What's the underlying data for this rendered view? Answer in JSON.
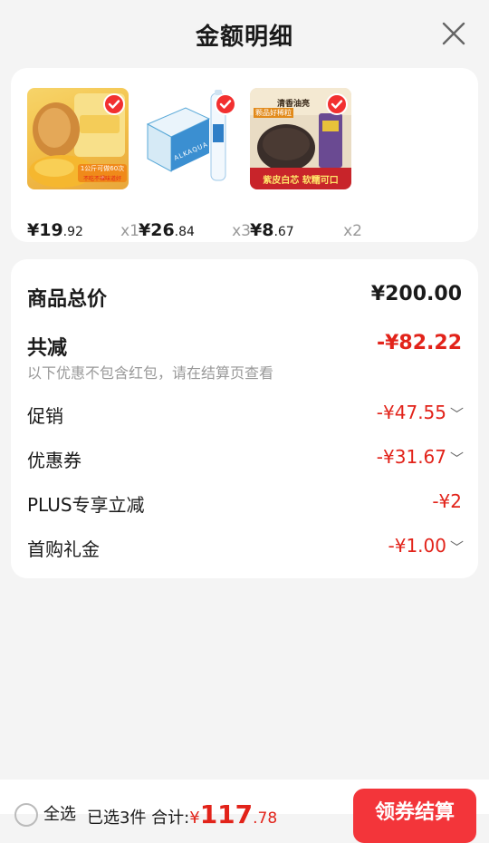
{
  "title": "金额明细",
  "products": [
    {
      "price_int": "¥19",
      "price_dec": ".92",
      "qty": "x1",
      "thumb_text_1": "1公斤可做60次+",
      "thumb_text_2": "不吃不裸味道好"
    },
    {
      "price_int": "¥26",
      "price_dec": ".84",
      "qty": "x3",
      "thumb_text_1": "ALKAQUA"
    },
    {
      "price_int": "¥8",
      "price_dec": ".67",
      "qty": "x2",
      "thumb_text_1": "清香油亮",
      "thumb_text_2": "颗品好稀粒",
      "thumb_text_3": "紫皮白芯 软糯可口"
    }
  ],
  "details": {
    "total_label": "商品总价",
    "total_value": "¥200.00",
    "discount_label": "共减",
    "discount_value": "-¥82.22",
    "discount_note": "以下优惠不包含红包，请在结算页查看",
    "items": [
      {
        "label": "促销",
        "value": "-¥47.55",
        "chevron": true
      },
      {
        "label": "优惠券",
        "value": "-¥31.67",
        "chevron": true
      },
      {
        "label": "PLUS专享立减",
        "value": "-¥2",
        "chevron": false
      },
      {
        "label": "首购礼金",
        "value": "-¥1.00",
        "chevron": true
      }
    ]
  },
  "bottom": {
    "select_all": "全选",
    "summary": "已选3件 合计:",
    "total_yen": "¥",
    "total_int": "117",
    "total_dec": ".78",
    "checkout": "领券结算"
  },
  "colors": {
    "accent": "#e2231a",
    "checkout_bg": "#f3353a",
    "muted": "#999999"
  }
}
